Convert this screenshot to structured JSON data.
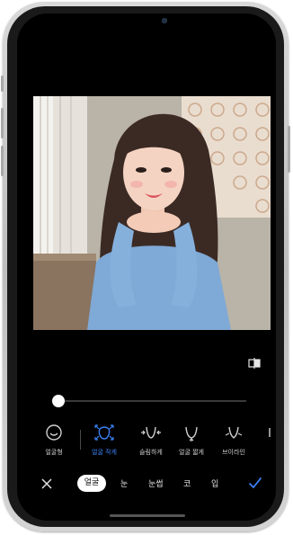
{
  "colors": {
    "accent": "#3b82f6",
    "screen_bg": "#000000",
    "text": "#cfcfcf",
    "active_tab_bg": "#ffffff"
  },
  "photo": {
    "description_icon": "portrait-photo"
  },
  "compare": {
    "icon": "compare-icon"
  },
  "slider": {
    "value": 0.0
  },
  "tools": [
    {
      "label": "얼굴형",
      "icon": "face-shape-icon"
    },
    {
      "label": "얼굴 작게",
      "icon": "face-small-icon",
      "active": true
    },
    {
      "label": "슬림하게",
      "icon": "slim-icon"
    },
    {
      "label": "얼굴 짧게",
      "icon": "face-short-icon"
    },
    {
      "label": "브이라인",
      "icon": "v-line-icon"
    }
  ],
  "tabs": [
    {
      "label": "얼굴",
      "active": true
    },
    {
      "label": "눈"
    },
    {
      "label": "눈썹"
    },
    {
      "label": "코"
    },
    {
      "label": "입"
    }
  ],
  "actions": {
    "close_icon": "close-icon",
    "confirm_icon": "check-icon"
  }
}
